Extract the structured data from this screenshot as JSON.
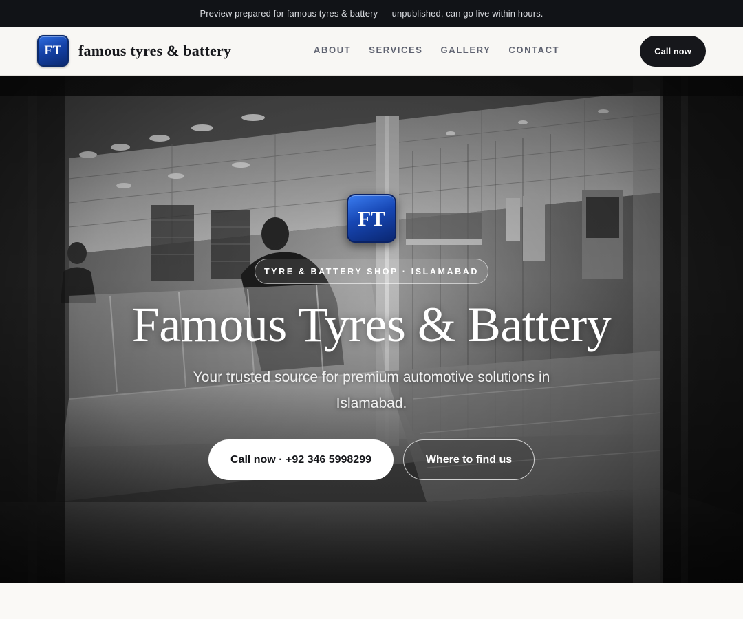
{
  "banner": {
    "text": "Preview prepared for famous tyres & battery — unpublished, can go live within hours."
  },
  "header": {
    "logo_text": "FT",
    "brand_name": "famous tyres & battery",
    "nav": [
      {
        "label": "ABOUT"
      },
      {
        "label": "SERVICES"
      },
      {
        "label": "GALLERY"
      },
      {
        "label": "CONTACT"
      }
    ],
    "cta_label": "Call now"
  },
  "hero": {
    "logo_text": "FT",
    "eyebrow": "TYRE & BATTERY SHOP · ISLAMABAD",
    "title": "Famous Tyres & Battery",
    "subtitle": "Your trusted source for premium automotive solutions in Islamabad.",
    "primary_button": "Call now · +92 346 5998299",
    "secondary_button": "Where to find us",
    "background_image": "black-and-white shop interior photo"
  },
  "colors": {
    "banner_bg": "#111317",
    "header_bg": "#f8f7f4",
    "dark_button": "#16171b",
    "logo_blue": "#1747b4",
    "page_bg": "#faf9f6"
  }
}
